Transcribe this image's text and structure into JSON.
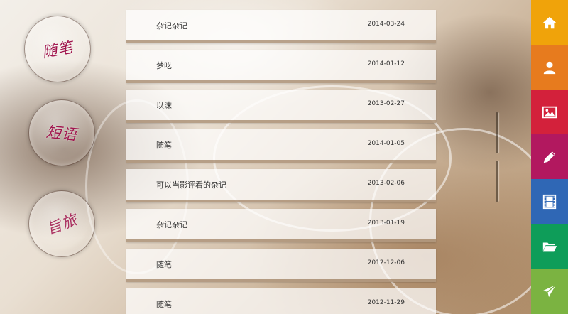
{
  "circles": [
    {
      "label": "随笔",
      "icon": "handwritten-suibi"
    },
    {
      "label": "短语",
      "icon": "handwritten-duanyu"
    },
    {
      "label": "旨旅",
      "icon": "handwritten-travel"
    }
  ],
  "entries": [
    {
      "title": "杂记杂记",
      "date": "2014-03-24"
    },
    {
      "title": "梦呓",
      "date": "2014-01-12"
    },
    {
      "title": "以沫",
      "date": "2013-02-27"
    },
    {
      "title": "随笔",
      "date": "2014-01-05"
    },
    {
      "title": "可以当影评看的杂记",
      "date": "2013-02-06"
    },
    {
      "title": "杂记杂记",
      "date": "2013-01-19"
    },
    {
      "title": "随笔",
      "date": "2012-12-06"
    },
    {
      "title": "随笔",
      "date": "2012-11-29"
    }
  ],
  "side_menu": [
    {
      "icon": "home-icon",
      "color": "#f0a30a"
    },
    {
      "icon": "user-icon",
      "color": "#e77b1e"
    },
    {
      "icon": "image-icon",
      "color": "#d3213b"
    },
    {
      "icon": "pencil-icon",
      "color": "#b2185f"
    },
    {
      "icon": "film-icon",
      "color": "#2f67b5"
    },
    {
      "icon": "folder-icon",
      "color": "#0e9d59"
    },
    {
      "icon": "send-icon",
      "color": "#7bb341"
    }
  ]
}
